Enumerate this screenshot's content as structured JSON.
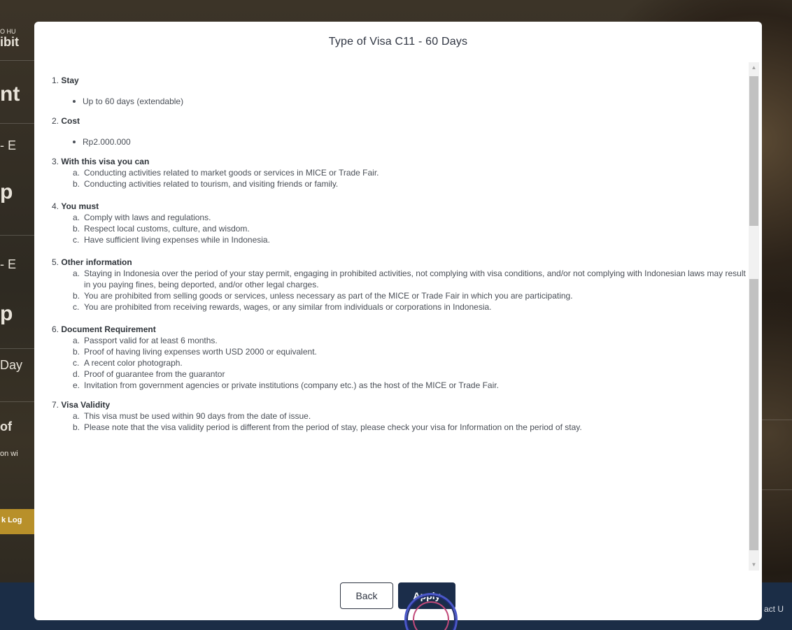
{
  "background": {
    "fragments": {
      "top_small": "O HU",
      "top": "ibit",
      "f1": "nt",
      "f2": "- E",
      "f3": "p",
      "f4": "- E",
      "f5": "p",
      "f6": "Day",
      "f7": "of",
      "f8": "on wi",
      "button": "k Log",
      "footer_right": "act U"
    }
  },
  "modal": {
    "title": "Type of Visa C11 - 60 Days",
    "sections": [
      {
        "number": "1.",
        "heading": "Stay",
        "bullets": [
          "Up to 60 days (extendable)"
        ]
      },
      {
        "number": "2.",
        "heading": "Cost",
        "bullets": [
          "Rp2.000.000"
        ]
      },
      {
        "number": "3.",
        "heading": "With this visa you can",
        "items": [
          {
            "letter": "a.",
            "text": "Conducting activities related to market goods or services in MICE or Trade Fair."
          },
          {
            "letter": "b.",
            "text": "Conducting activities related to tourism, and visiting friends or family."
          }
        ]
      },
      {
        "number": "4.",
        "heading": "You must",
        "items": [
          {
            "letter": "a.",
            "text": "Comply with laws and regulations."
          },
          {
            "letter": "b.",
            "text": "Respect local customs, culture, and wisdom."
          },
          {
            "letter": "c.",
            "text": "Have sufficient living expenses while in Indonesia."
          }
        ]
      },
      {
        "number": "5.",
        "heading": "Other information",
        "items": [
          {
            "letter": "a.",
            "text": "Staying in Indonesia over the period of your stay permit, engaging in prohibited activities, not complying with visa conditions, and/or not complying with Indonesian laws may result in you paying fines, being deported, and/or other legal charges."
          },
          {
            "letter": "b.",
            "text": "You are prohibited from selling goods or services, unless necessary as part of the MICE or Trade Fair in which you are participating."
          },
          {
            "letter": "c.",
            "text": "You are prohibited from receiving rewards, wages, or any similar from individuals or corporations in Indonesia."
          }
        ]
      },
      {
        "number": "6.",
        "heading": "Document Requirement",
        "items": [
          {
            "letter": "a.",
            "text": "Passport valid for at least 6 months."
          },
          {
            "letter": "b.",
            "text": "Proof of having living expenses worth USD 2000 or equivalent."
          },
          {
            "letter": "c.",
            "text": "A recent color photograph."
          },
          {
            "letter": "d.",
            "text": "Proof of guarantee from the guarantor"
          },
          {
            "letter": "e.",
            "text": "Invitation from government agencies or private institutions (company etc.) as the host of the MICE or Trade Fair."
          }
        ]
      },
      {
        "number": "7.",
        "heading": "Visa Validity",
        "items": [
          {
            "letter": "a.",
            "text": "This visa must be used within 90 days from the date of issue."
          },
          {
            "letter": "b.",
            "text": "Please note that the visa validity period is different from the period of stay, please check your visa for Information on the period of stay."
          }
        ]
      }
    ],
    "buttons": {
      "back": "Back",
      "apply": "Apply"
    },
    "scrollbar": {
      "up_arrow": "▲",
      "down_arrow": "▼"
    }
  }
}
